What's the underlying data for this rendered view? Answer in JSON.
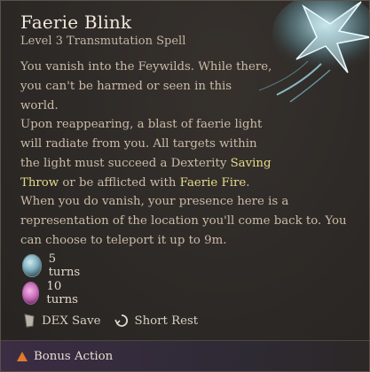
{
  "spell": {
    "name": "Faerie Blink",
    "subtitle": "Level 3 Transmutation Spell"
  },
  "description": {
    "p1": "You vanish into the Feywilds. While there, you can't be harmed or seen in this world.",
    "p2_before": "Upon reappearing, a blast of faerie light will radiate from you. All targets within the light must succeed a Dexterity ",
    "p2_link1": "Saving Throw",
    "p2_middle": " or be afflicted with ",
    "p2_link2": "Faerie Fire",
    "p2_after": ".",
    "p3": "When you do vanish, your presence here is a representation of the location you'll come back to. You can choose to teleport it up to 9m."
  },
  "effects": [
    {
      "icon": "faerie-blink-icon",
      "label": "5 turns"
    },
    {
      "icon": "faerie-fire-icon",
      "label": "10 turns"
    }
  ],
  "meta": {
    "save": "DEX Save",
    "save_icon": "shield-icon",
    "rest": "Short Rest",
    "rest_icon": "short-rest-icon"
  },
  "footer": {
    "action": "Bonus Action",
    "action_icon": "triangle-icon",
    "action_color": "#e07a2c"
  },
  "colors": {
    "highlight": "#e8dc8c",
    "body_text": "#cbbca9"
  }
}
